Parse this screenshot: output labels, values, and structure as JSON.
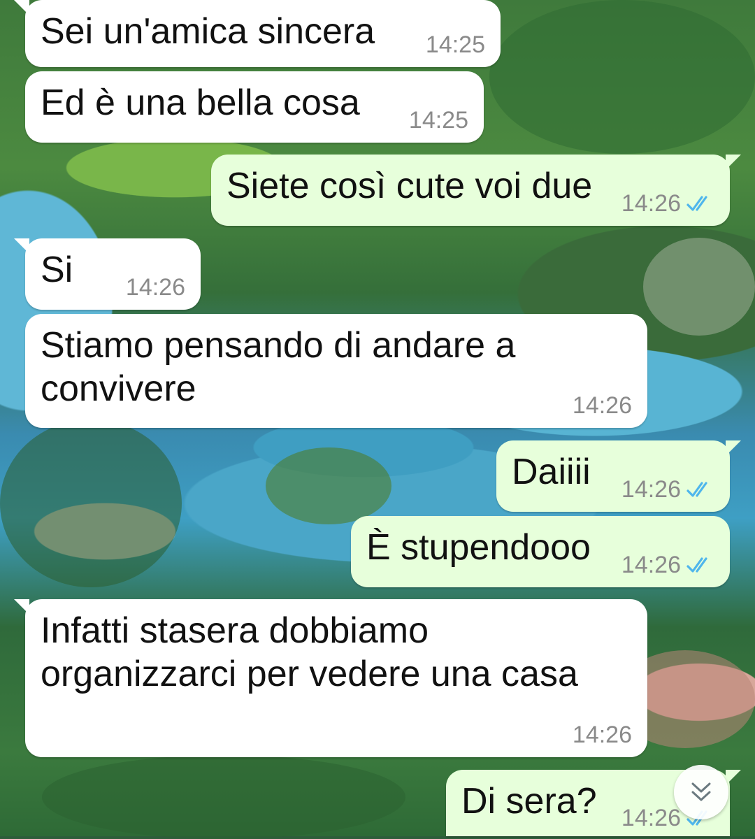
{
  "theme": {
    "incoming_bubble": "#ffffff",
    "outgoing_bubble": "#e7ffdb",
    "timestamp_color": "#8a8a8a",
    "read_tick_color": "#4fb6ec"
  },
  "messages": [
    {
      "direction": "in",
      "text": "Sei un'amica sincera",
      "time": "14:25"
    },
    {
      "direction": "in",
      "text": "Ed è una bella cosa",
      "time": "14:25"
    },
    {
      "direction": "out",
      "text": "Siete così cute voi due",
      "time": "14:26",
      "status_icon": "double-check-read-icon"
    },
    {
      "direction": "in",
      "text": "Si",
      "time": "14:26"
    },
    {
      "direction": "in",
      "text": "Stiamo pensando di andare a\nconvivere",
      "time": "14:26"
    },
    {
      "direction": "out",
      "text": "Daiiii",
      "time": "14:26",
      "status_icon": "double-check-read-icon"
    },
    {
      "direction": "out",
      "text": "È stupendooo",
      "time": "14:26",
      "status_icon": "double-check-read-icon"
    },
    {
      "direction": "in",
      "text": "Infatti stasera dobbiamo\norganizzarci per vedere una casa",
      "time": "14:26"
    },
    {
      "direction": "out",
      "text": "Di sera?",
      "time": "14:26",
      "status_icon": "double-check-read-icon"
    }
  ],
  "scroll_button": {
    "icon": "double-chevron-down-icon"
  }
}
